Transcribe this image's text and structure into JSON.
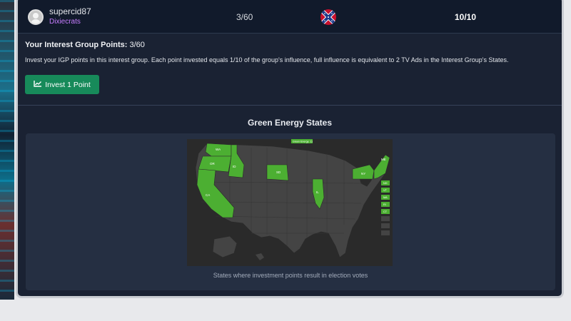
{
  "member": {
    "username": "supercid87",
    "party": "Dixiecrats",
    "points": "3/60",
    "influence": "10/10",
    "flag_icon": "confederate-flag-icon"
  },
  "invest": {
    "igp_label": "Your Interest Group Points:",
    "igp_value": "3/60",
    "description": "Invest your IGP points in this interest group. Each point invested equals 1/10 of the group's influence, full influence is equivalent to 2 TV Ads in the Interest Group's States.",
    "button_label": "Invest 1 Point",
    "button_icon": "chart-line-icon",
    "button_color": "#178a5a"
  },
  "map": {
    "title": "Green Energy States",
    "legend_title": "Green Energy: 11",
    "caption": "States where investment points result in election votes",
    "highlight_color": "#4caf32",
    "base_color": "#444444",
    "highlighted_states": [
      "WA",
      "OR",
      "CA",
      "ID",
      "SD",
      "IL",
      "NY",
      "ME",
      "NH",
      "VT",
      "MA",
      "RI",
      "CT"
    ],
    "map_labels": {
      "WA": "WA",
      "OR": "OR",
      "CA": "CA",
      "ID": "ID",
      "SD": "SD",
      "IL": "IL",
      "NY": "NY",
      "ME": "ME"
    },
    "side_labels": [
      "NH",
      "VT",
      "MA",
      "RI",
      "CT"
    ]
  }
}
